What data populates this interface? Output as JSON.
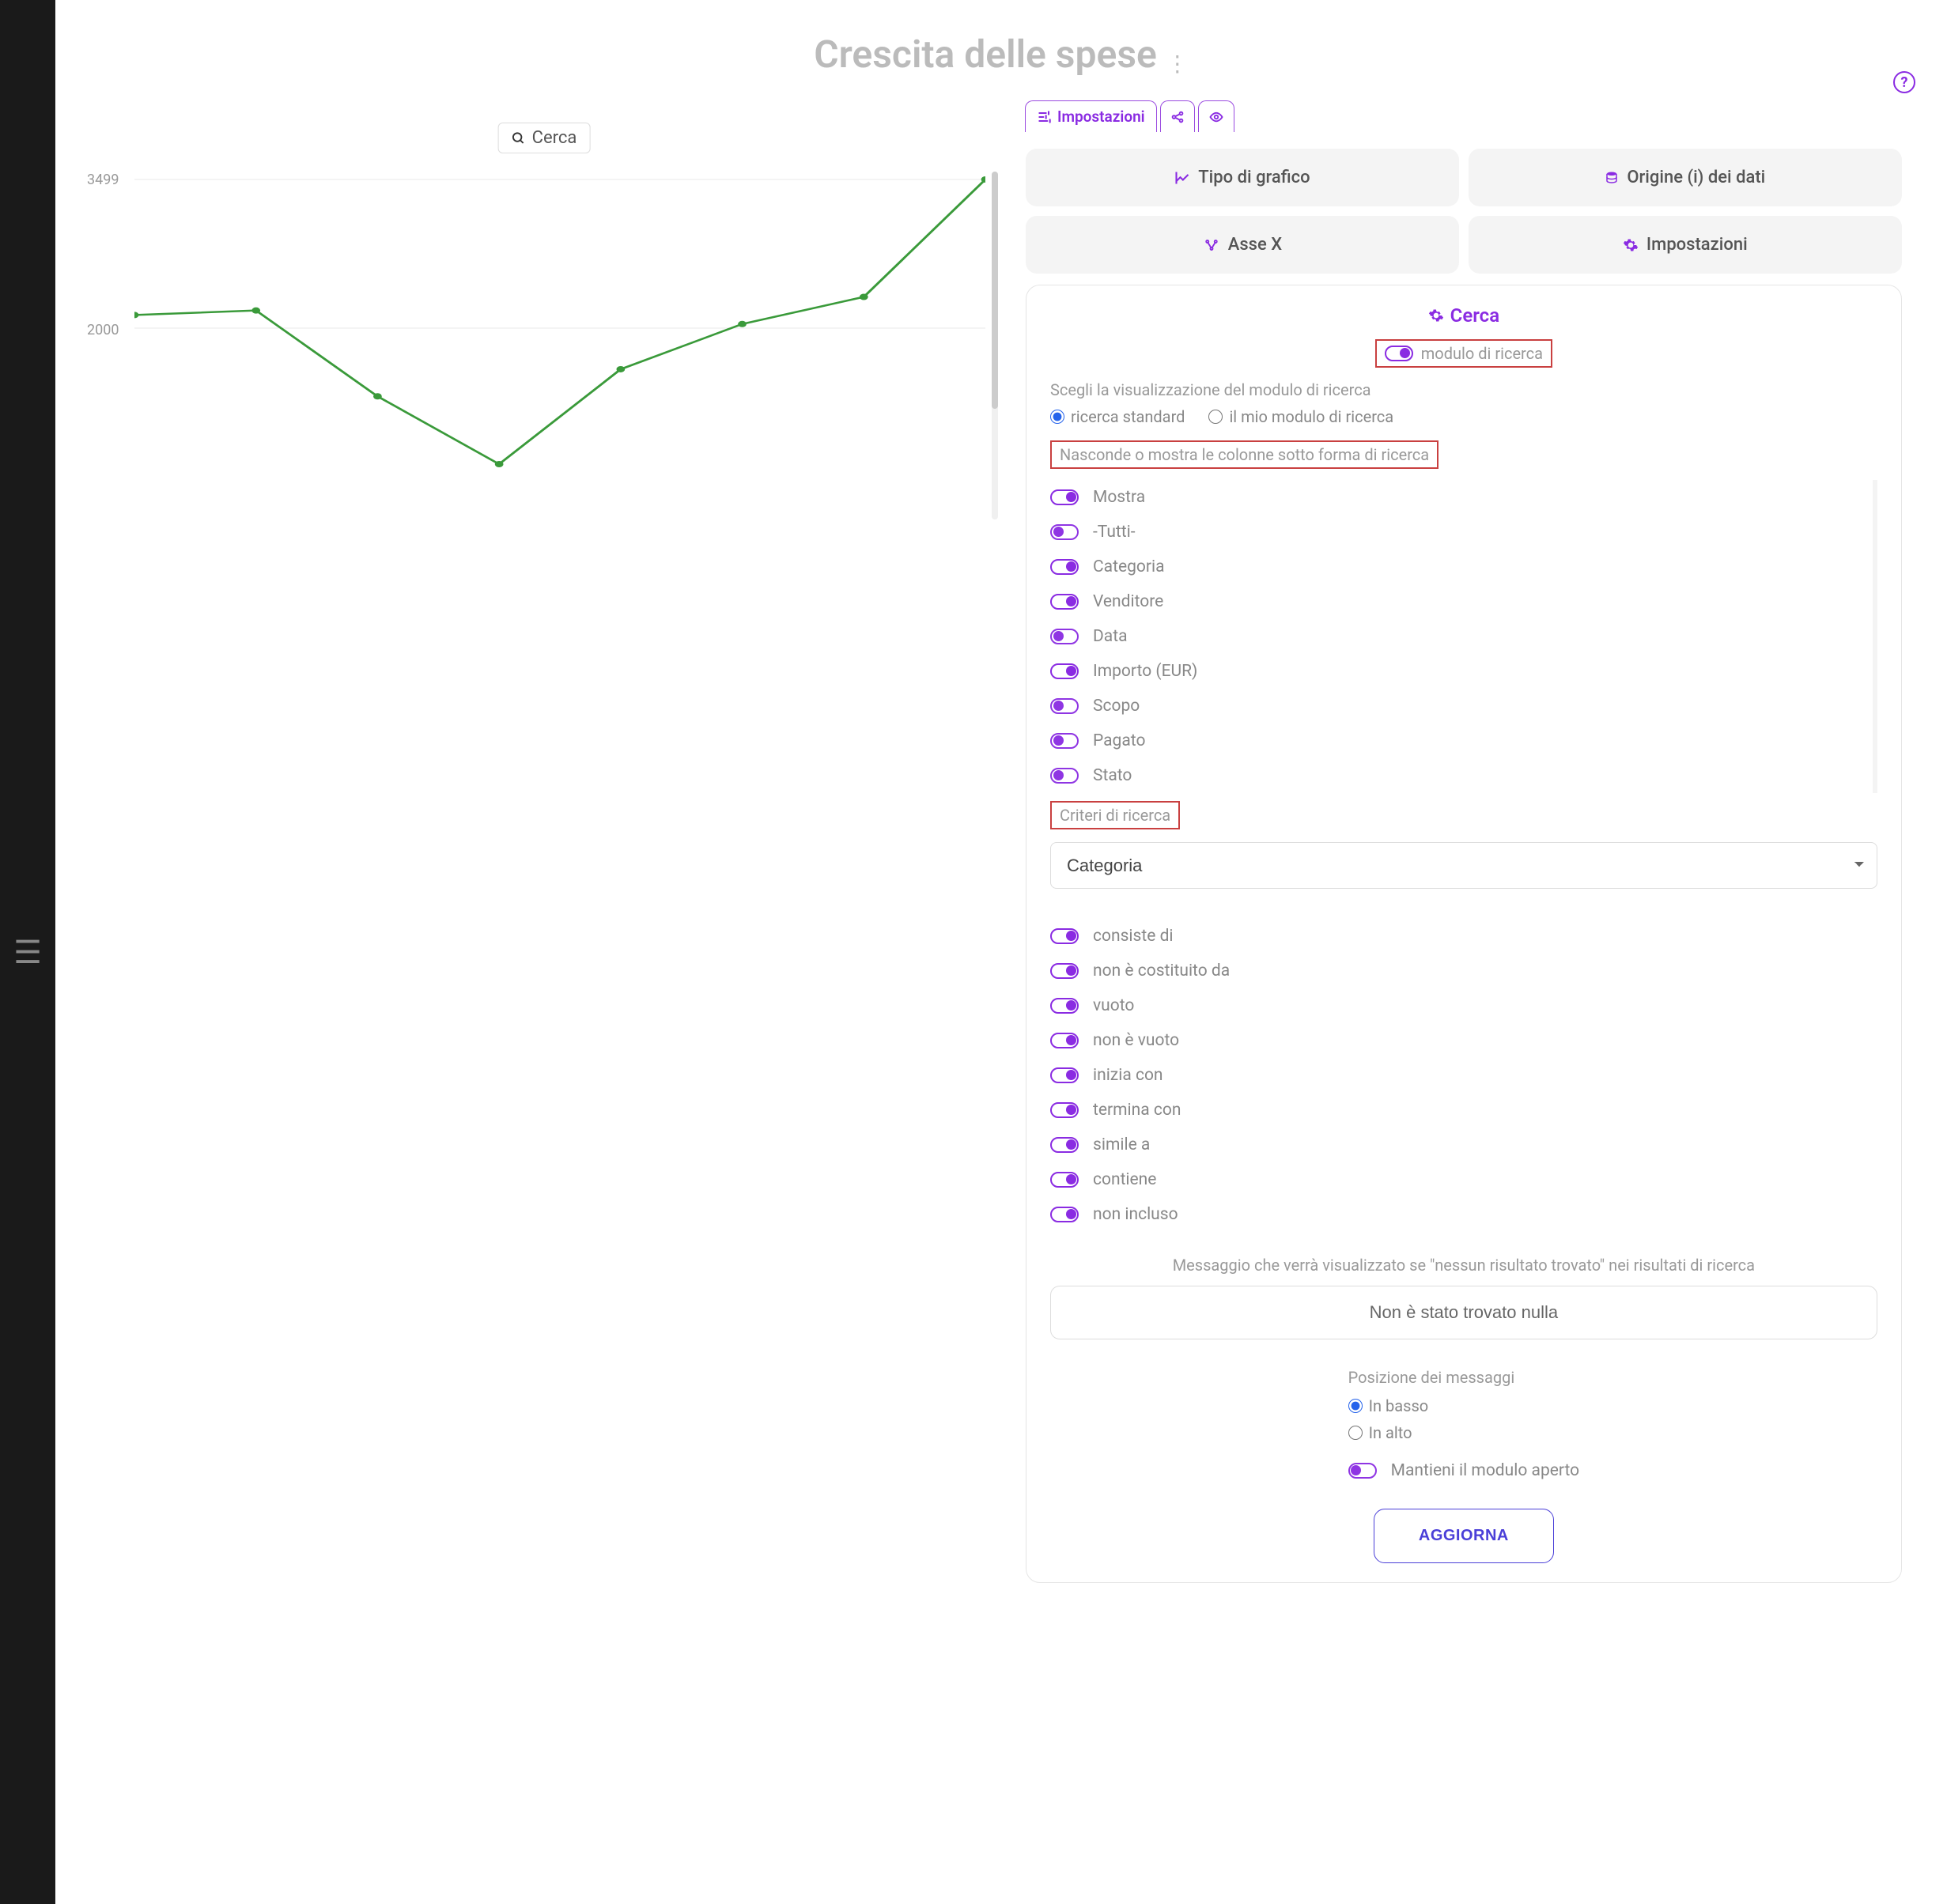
{
  "page": {
    "title": "Crescita delle spese"
  },
  "chart": {
    "search_label": "Cerca"
  },
  "chart_data": {
    "type": "line",
    "x": [
      0,
      1,
      2,
      3,
      4,
      5,
      6,
      7
    ],
    "values": [
      2000,
      2050,
      1100,
      350,
      1400,
      1900,
      2200,
      3499
    ],
    "yticks": [
      2000,
      3499
    ],
    "ylim": [
      0,
      3499
    ],
    "title": "",
    "xlabel": "",
    "ylabel": ""
  },
  "tabs": {
    "settings": "Impostazioni"
  },
  "big_buttons": {
    "chart_type": "Tipo di grafico",
    "data_source": "Origine (i) dei dati",
    "x_axis": "Asse X",
    "settings": "Impostazioni"
  },
  "search_card": {
    "title": "Cerca",
    "module_toggle": "modulo di ricerca",
    "choose_view": "Scegli la visualizzazione del modulo di ricerca",
    "radio_standard": "ricerca standard",
    "radio_custom": "il mio modulo di ricerca",
    "hide_show": "Nasconde o mostra le colonne sotto forma di ricerca",
    "columns": [
      {
        "label": "Mostra",
        "on": true
      },
      {
        "label": "-Tutti-",
        "on": false
      },
      {
        "label": "Categoria",
        "on": true
      },
      {
        "label": "Venditore",
        "on": true
      },
      {
        "label": "Data",
        "on": false
      },
      {
        "label": "Importo (EUR)",
        "on": true
      },
      {
        "label": "Scopo",
        "on": false
      },
      {
        "label": "Pagato",
        "on": false
      },
      {
        "label": "Stato",
        "on": false
      }
    ],
    "criteria_label": "Criteri di ricerca",
    "select_value": "Categoria",
    "criteria": [
      {
        "label": "consiste di",
        "on": true
      },
      {
        "label": "non è costituito da",
        "on": true
      },
      {
        "label": "vuoto",
        "on": true
      },
      {
        "label": "non è vuoto",
        "on": true
      },
      {
        "label": "inizia con",
        "on": true
      },
      {
        "label": "termina con",
        "on": true
      },
      {
        "label": "simile a",
        "on": true
      },
      {
        "label": "contiene",
        "on": true
      },
      {
        "label": "non incluso",
        "on": true
      }
    ],
    "msg_label": "Messaggio che verrà visualizzato se \"nessun risultato trovato\" nei risultati di ricerca",
    "msg_value": "Non è stato trovato nulla",
    "pos_label": "Posizione dei messaggi",
    "pos_bottom": "In basso",
    "pos_top": "In alto",
    "keep_open": "Mantieni il modulo aperto",
    "update": "AGGIORNA"
  }
}
